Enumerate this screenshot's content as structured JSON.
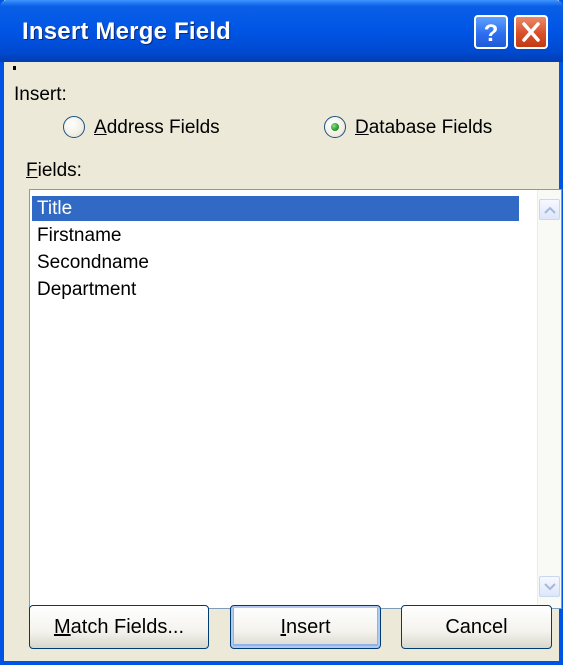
{
  "dialog": {
    "title": "Insert Merge Field",
    "help_button_glyph": "?",
    "close_button_glyph": "✕"
  },
  "insert_group": {
    "label": "Insert:",
    "options": [
      {
        "accel": "A",
        "rest": "ddress Fields",
        "label": "Address Fields",
        "selected": false
      },
      {
        "accel": "D",
        "rest": "atabase Fields",
        "label": "Database Fields",
        "selected": true
      }
    ]
  },
  "fields": {
    "label_accel": "F",
    "label_rest": "ields:",
    "items": [
      "Title",
      "Firstname",
      "Secondname",
      "Department"
    ],
    "selected_index": 0
  },
  "buttons": {
    "match_fields": {
      "accel": "M",
      "rest": "atch Fields...",
      "label": "Match Fields..."
    },
    "insert": {
      "accel": "I",
      "rest": "nsert",
      "label": "Insert"
    },
    "cancel": {
      "label": "Cancel"
    }
  },
  "colors": {
    "titlebar": "#0055e5",
    "selection": "#316ac5",
    "face": "#ece9d8"
  },
  "icons": {
    "help": "question-mark-icon",
    "close": "close-x-icon",
    "scroll_up": "arrow-up-icon",
    "scroll_down": "arrow-down-icon"
  }
}
